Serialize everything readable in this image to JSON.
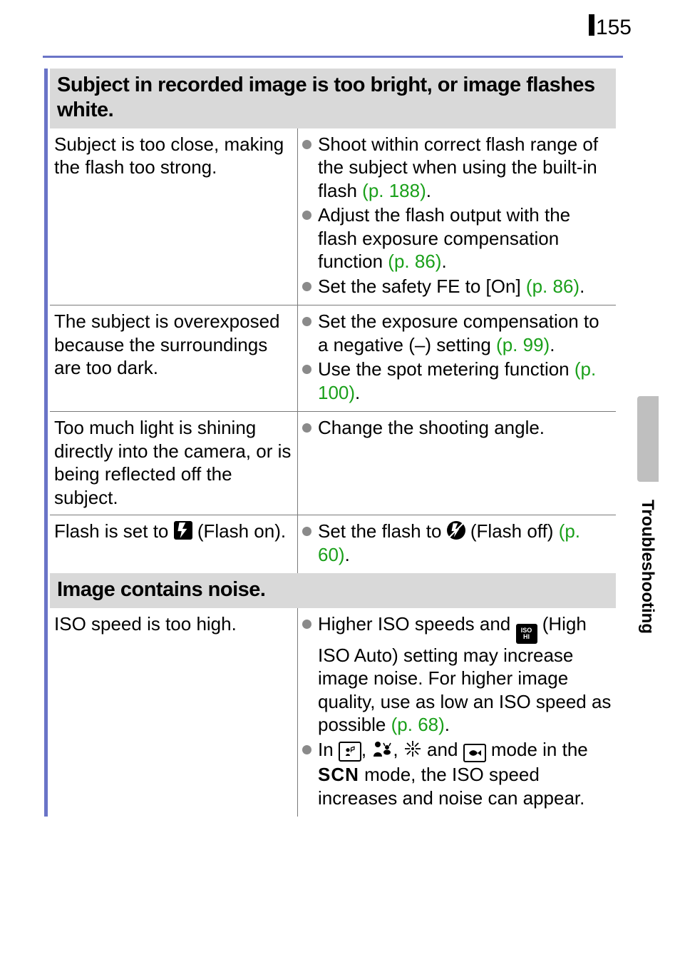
{
  "page_number": "155",
  "side_tab_label": "Troubleshooting",
  "sections": [
    {
      "header": "Subject in recorded image is too bright, or image flashes white.",
      "rows": [
        {
          "cause": "Subject is too close, making the flash too strong.",
          "remedies": [
            {
              "prefix": "Shoot within correct flash range of the subject when using the built-in flash ",
              "pref": "(p. 188)",
              "suffix": "."
            },
            {
              "prefix": "Adjust the flash output with the flash exposure compensation function ",
              "pref": "(p. 86)",
              "suffix": "."
            },
            {
              "prefix": "Set the safety FE to [On] ",
              "pref": "(p. 86)",
              "suffix": "."
            }
          ]
        },
        {
          "cause": "The subject is overexposed because the surroundings are too dark.",
          "remedies": [
            {
              "prefix": "Set the exposure compensation to a negative (–) setting ",
              "pref": "(p. 99)",
              "suffix": "."
            },
            {
              "prefix": "Use the spot metering function ",
              "pref": "(p. 100)",
              "suffix": "."
            }
          ]
        },
        {
          "cause": "Too much light is shining directly into the camera, or is being reflected off the subject.",
          "remedies": [
            {
              "prefix": "Change the shooting angle.",
              "pref": "",
              "suffix": ""
            }
          ]
        },
        {
          "cause_prefix": "Flash is set to ",
          "cause_icon": "flash-on-icon",
          "cause_suffix": " (Flash on).",
          "remedies": [
            {
              "prefix": "Set the flash to ",
              "icon": "flash-off-icon",
              "mid": " (Flash off) ",
              "pref": "(p. 60)",
              "suffix": "."
            }
          ]
        }
      ]
    },
    {
      "header": "Image contains noise.",
      "rows": [
        {
          "cause": "ISO speed is too high.",
          "remedies": [
            {
              "prefix": "Higher ISO speeds and ",
              "icon": "iso-hi-icon",
              "mid": " (High ISO Auto) setting may increase image noise. For higher image quality, use as low an ISO speed as possible ",
              "pref": "(p. 68)",
              "suffix": "."
            },
            {
              "prefix": "In ",
              "icons_list": [
                "indoor-icon",
                "kids-pets-icon",
                "fireworks-icon",
                "aquarium-icon"
              ],
              "mid": " mode in the ",
              "scn": "SCN",
              "mid2": " mode, the ISO speed increases and noise can appear.",
              "pref": "",
              "suffix": ""
            }
          ]
        }
      ]
    }
  ]
}
